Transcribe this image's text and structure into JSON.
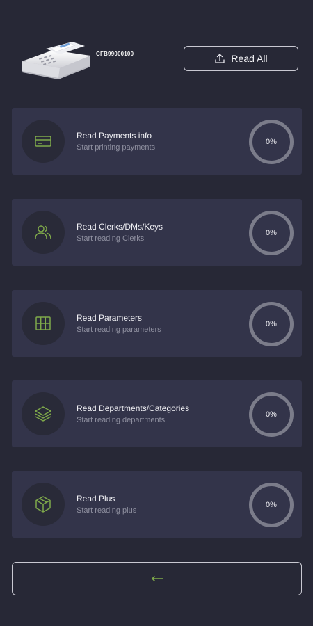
{
  "header": {
    "serial": "CFB99000100",
    "read_all_label": "Read All"
  },
  "colors": {
    "background": "#272836",
    "card": "#33344a",
    "accent_green": "#7fa94a",
    "progress_ring": "#7b7c8a"
  },
  "cards": [
    {
      "title": "Read Payments info",
      "subtitle": "Start printing payments",
      "progress": "0%",
      "icon": "credit-card-icon"
    },
    {
      "title": "Read Clerks/DMs/Keys",
      "subtitle": "Start reading Clerks",
      "progress": "0%",
      "icon": "users-icon"
    },
    {
      "title": "Read Parameters",
      "subtitle": "Start reading parameters",
      "progress": "0%",
      "icon": "grid-icon"
    },
    {
      "title": "Read Departments/Categories",
      "subtitle": "Start reading departments",
      "progress": "0%",
      "icon": "layers-icon"
    },
    {
      "title": "Read Plus",
      "subtitle": "Start reading plus",
      "progress": "0%",
      "icon": "box-icon"
    }
  ],
  "footer": {
    "back_icon": "arrow-left-icon"
  }
}
